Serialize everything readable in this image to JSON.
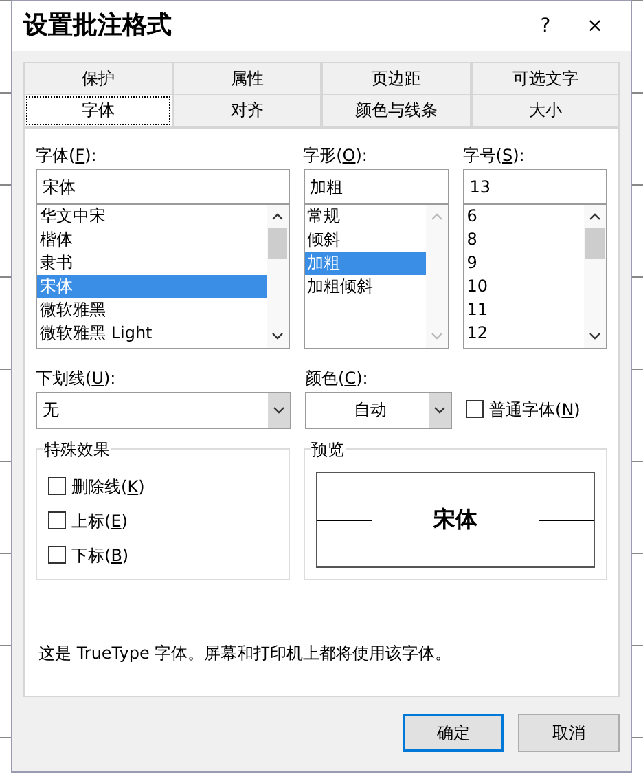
{
  "window": {
    "title": "设置批注格式",
    "help": "?",
    "close": "×"
  },
  "tabs": [
    [
      {
        "label": "保护",
        "selected": false
      },
      {
        "label": "属性",
        "selected": false
      },
      {
        "label": "页边距",
        "selected": false
      },
      {
        "label": "可选文字",
        "selected": false
      }
    ],
    [
      {
        "label": "字体",
        "selected": true
      },
      {
        "label": "对齐",
        "selected": false
      },
      {
        "label": "颜色与线条",
        "selected": false
      },
      {
        "label": "大小",
        "selected": false
      }
    ]
  ],
  "font_columns": [
    {
      "label": [
        "字体(",
        "F",
        "):"
      ],
      "value": "宋体",
      "items": [
        {
          "text": "华文中宋",
          "selected": false
        },
        {
          "text": "楷体",
          "selected": false
        },
        {
          "text": "隶书",
          "selected": false
        },
        {
          "text": "宋体",
          "selected": true
        },
        {
          "text": "微软雅黑",
          "selected": false
        },
        {
          "text": "微软雅黑 Light",
          "selected": false
        }
      ],
      "scroll_enabled": true
    },
    {
      "label": [
        "字形(",
        "O",
        "):"
      ],
      "value": "加粗",
      "items": [
        {
          "text": "常规",
          "selected": false
        },
        {
          "text": "倾斜",
          "selected": false
        },
        {
          "text": "加粗",
          "selected": true
        },
        {
          "text": "加粗倾斜",
          "selected": false
        }
      ],
      "scroll_enabled": false
    },
    {
      "label": [
        "字号(",
        "S",
        "):"
      ],
      "value": "13",
      "items": [
        {
          "text": "6",
          "selected": false
        },
        {
          "text": "8",
          "selected": false
        },
        {
          "text": "9",
          "selected": false
        },
        {
          "text": "10",
          "selected": false
        },
        {
          "text": "11",
          "selected": false
        },
        {
          "text": "12",
          "selected": false
        }
      ],
      "scroll_enabled": true
    }
  ],
  "underline": {
    "label": [
      "下划线(",
      "U",
      "):"
    ],
    "value": "无"
  },
  "color": {
    "label": [
      "颜色(",
      "C",
      "):"
    ],
    "value": "自动"
  },
  "normal_font": {
    "label": [
      "普通字体(",
      "N",
      ")"
    ],
    "checked": false
  },
  "effects": {
    "title": "特殊效果",
    "items": [
      {
        "label": [
          "删除线(",
          "K",
          ")"
        ],
        "checked": false
      },
      {
        "label": [
          "上标(",
          "E",
          ")"
        ],
        "checked": false
      },
      {
        "label": [
          "下标(",
          "B",
          ")"
        ],
        "checked": false
      }
    ]
  },
  "preview": {
    "title": "预览",
    "sample": "宋体"
  },
  "description": "这是 TrueType 字体。屏幕和打印机上都将使用该字体。",
  "buttons": [
    {
      "label": "确定",
      "default": true
    },
    {
      "label": "取消",
      "default": false
    }
  ]
}
